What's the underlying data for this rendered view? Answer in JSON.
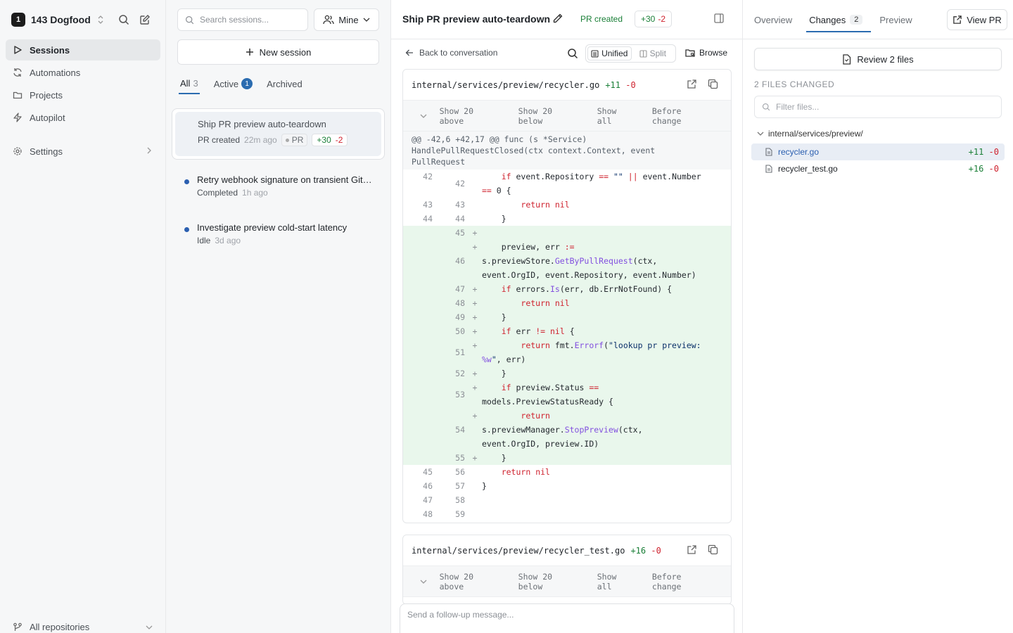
{
  "workspace": {
    "badge": "1",
    "name": "143 Dogfood"
  },
  "nav": {
    "items": [
      {
        "label": "Sessions"
      },
      {
        "label": "Automations"
      },
      {
        "label": "Projects"
      },
      {
        "label": "Autopilot"
      }
    ],
    "settings": "Settings",
    "repos": "All repositories"
  },
  "sessions": {
    "search_placeholder": "Search sessions...",
    "filter_owner": "Mine",
    "new_session": "New session",
    "tabs": [
      {
        "label": "All",
        "count": "3"
      },
      {
        "label": "Active",
        "count": "1"
      },
      {
        "label": "Archived"
      }
    ],
    "list": [
      {
        "title": "Ship PR preview auto-teardown",
        "status": "PR created",
        "ago": "22m ago",
        "pr": "PR",
        "add": "+30",
        "del": "-2"
      },
      {
        "title": "Retry webhook signature on transient GitH...",
        "status": "Completed",
        "ago": "1h ago"
      },
      {
        "title": "Investigate preview cold-start latency",
        "status": "Idle",
        "ago": "3d ago"
      }
    ]
  },
  "center": {
    "title": "Ship PR preview auto-teardown",
    "status": "PR created",
    "add": "+30",
    "del": "-2",
    "back": "Back to conversation",
    "view_unified": "Unified",
    "view_split": "Split",
    "browse": "Browse",
    "followup_placeholder": "Send a follow-up message...",
    "expander": {
      "above": "Show 20 above",
      "below": "Show 20 below",
      "all": "Show all",
      "before": "Before change"
    },
    "files": [
      {
        "path": "internal/services/preview/recycler.go",
        "add": "+11",
        "del": "-0",
        "hunk": "@@ -42,6 +42,17 @@ func (s *Service)\nHandlePullRequestClosed(ctx context.Context, event\nPullRequest",
        "lines": [
          {
            "o": "42",
            "n": "42",
            "m": "",
            "t": "ctx",
            "code": "    if event.Repository == \"\" || event.Number\n== 0 {"
          },
          {
            "o": "43",
            "n": "43",
            "m": "",
            "t": "ctx",
            "code": "        return nil"
          },
          {
            "o": "44",
            "n": "44",
            "m": "",
            "t": "ctx",
            "code": "    }"
          },
          {
            "o": "",
            "n": "45",
            "m": "+",
            "t": "add",
            "code": ""
          },
          {
            "o": "",
            "n": "46",
            "m": "+",
            "t": "add",
            "code": "    preview, err :=\ns.previewStore.GetByPullRequest(ctx,\nevent.OrgID, event.Repository, event.Number)"
          },
          {
            "o": "",
            "n": "47",
            "m": "+",
            "t": "add",
            "code": "    if errors.Is(err, db.ErrNotFound) {"
          },
          {
            "o": "",
            "n": "48",
            "m": "+",
            "t": "add",
            "code": "        return nil"
          },
          {
            "o": "",
            "n": "49",
            "m": "+",
            "t": "add",
            "code": "    }"
          },
          {
            "o": "",
            "n": "50",
            "m": "+",
            "t": "add",
            "code": "    if err != nil {"
          },
          {
            "o": "",
            "n": "51",
            "m": "+",
            "t": "add",
            "code": "        return fmt.Errorf(\"lookup pr preview:\n%w\", err)"
          },
          {
            "o": "",
            "n": "52",
            "m": "+",
            "t": "add",
            "code": "    }"
          },
          {
            "o": "",
            "n": "53",
            "m": "+",
            "t": "add",
            "code": "    if preview.Status ==\nmodels.PreviewStatusReady {"
          },
          {
            "o": "",
            "n": "54",
            "m": "+",
            "t": "add",
            "code": "        return\ns.previewManager.StopPreview(ctx,\nevent.OrgID, preview.ID)"
          },
          {
            "o": "",
            "n": "55",
            "m": "+",
            "t": "add",
            "code": "    }"
          },
          {
            "o": "45",
            "n": "56",
            "m": "",
            "t": "ctx",
            "code": "    return nil"
          },
          {
            "o": "46",
            "n": "57",
            "m": "",
            "t": "ctx",
            "code": "}"
          },
          {
            "o": "47",
            "n": "58",
            "m": "",
            "t": "ctx",
            "code": ""
          },
          {
            "o": "48",
            "n": "59",
            "m": "",
            "t": "ctx",
            "code": ""
          }
        ]
      },
      {
        "path": "internal/services/preview/recycler_test.go",
        "add": "+16",
        "del": "-0"
      }
    ]
  },
  "right": {
    "tabs": [
      {
        "label": "Overview"
      },
      {
        "label": "Changes",
        "count": "2"
      },
      {
        "label": "Preview"
      }
    ],
    "view_pr": "View PR",
    "review": "Review 2 files",
    "files_changed": "2 FILES CHANGED",
    "filter_placeholder": "Filter files...",
    "dir": "internal/services/preview/",
    "files": [
      {
        "name": "recycler.go",
        "add": "+11",
        "del": "-0"
      },
      {
        "name": "recycler_test.go",
        "add": "+16",
        "del": "-0"
      }
    ]
  },
  "colors": {
    "accent": "#2b6cb0",
    "add": "#1a7f37",
    "del": "#cf222e",
    "add_bg": "#e9f7ec"
  }
}
